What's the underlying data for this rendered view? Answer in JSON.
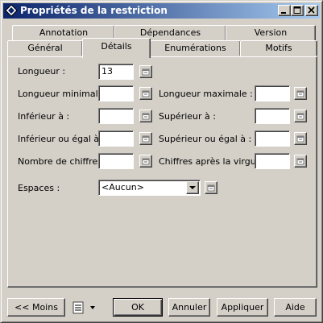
{
  "window": {
    "title": "Propriétés de la restriction",
    "controls": [
      "minimize-icon",
      "maximize-icon",
      "close-icon"
    ]
  },
  "tabs": {
    "row_back": [
      "Annotation",
      "Dépendances",
      "Version"
    ],
    "row_front": [
      "Général",
      "Détails",
      "Enumérations",
      "Motifs"
    ],
    "active": "Détails"
  },
  "fields": {
    "longueur": {
      "label": "Longueur :",
      "value": "13"
    },
    "longueur_min": {
      "label": "Longueur minimale :",
      "value": ""
    },
    "longueur_max": {
      "label": "Longueur maximale :",
      "value": ""
    },
    "inferieur": {
      "label": "Inférieur à :",
      "value": ""
    },
    "superieur": {
      "label": "Supérieur à :",
      "value": ""
    },
    "inferieur_egal": {
      "label": "Inférieur ou égal à :",
      "value": ""
    },
    "superieur_egal": {
      "label": "Supérieur ou égal à :",
      "value": ""
    },
    "nombre_chiffres": {
      "label": "Nombre de chiffres :",
      "value": ""
    },
    "chiffres_virgule": {
      "label": "Chiffres après la virgule :",
      "value": ""
    },
    "espaces": {
      "label": "Espaces :",
      "value": "<Aucun>"
    }
  },
  "buttons": {
    "moins": "<< Moins",
    "ok": "OK",
    "annuler": "Annuler",
    "appliquer": "Appliquer",
    "aide": "Aide"
  },
  "icons": {
    "title": "diamond-icon",
    "property": "properties-icon",
    "menu": "list-menu-icon"
  }
}
